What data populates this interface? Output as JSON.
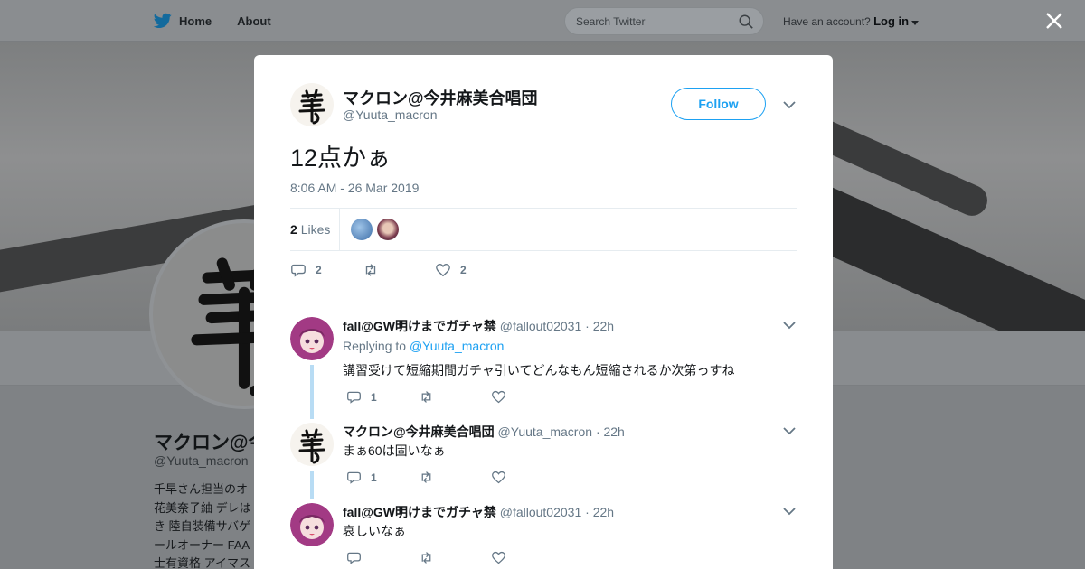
{
  "nav": {
    "home_label": "Home",
    "about_label": "About"
  },
  "search": {
    "placeholder": "Search Twitter"
  },
  "account": {
    "prompt": "Have an account?",
    "login_label": "Log in"
  },
  "profile": {
    "name": "マクロン@今井麻美合唱団",
    "handle": "@Yuuta_macron",
    "bio_lines": [
      "千早さん担当のオ",
      "花美奈子紬 デレは",
      "き 陸自装備サバゲ",
      "ールオーナー FAA",
      "士有資格 アイマス"
    ]
  },
  "tweet": {
    "author_name": "マクロン@今井麻美合唱団",
    "author_handle": "@Yuuta_macron",
    "follow_label": "Follow",
    "text": "12点かぁ",
    "timestamp": "8:06 AM - 26 Mar 2019",
    "likes_count": "2",
    "likes_label": "Likes",
    "reply_count": "2",
    "like_action_count": "2"
  },
  "replies": [
    {
      "name": "fall@GW明けまでガチャ禁",
      "handle": "@fallout02031",
      "time": "· 22h",
      "replying_prefix": "Replying to",
      "replying_to": "@Yuuta_macron",
      "text": "講習受けて短縮期間ガチャ引いてどんなもん短縮されるか次第っすね",
      "reply_count": "1"
    },
    {
      "name": "マクロン@今井麻美合唱団",
      "handle": "@Yuuta_macron",
      "time": "· 22h",
      "text": "まぁ60は固いなぁ",
      "reply_count": "1"
    },
    {
      "name": "fall@GW明けまでガチャ禁",
      "handle": "@fallout02031",
      "time": "· 22h",
      "text": "哀しいなぁ",
      "reply_count": ""
    }
  ],
  "colors": {
    "accent": "#1da1f2",
    "muted": "#657786",
    "thread": "#b8dcf4"
  }
}
